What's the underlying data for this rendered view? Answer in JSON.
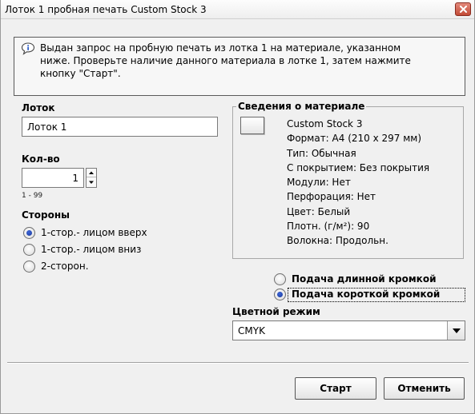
{
  "window": {
    "title": "Лоток 1 пробная печать Custom Stock 3"
  },
  "notice": {
    "line1": "Выдан запрос на пробную печать из лотка 1 на материале, указанном",
    "line2": "ниже.  Проверьте наличие данного материала в лотке 1, затем нажмите",
    "line3": "кнопку \"Старт\"."
  },
  "tray": {
    "label": "Лоток",
    "value": "Лоток 1"
  },
  "quantity": {
    "label": "Кол-во",
    "value": "1",
    "range": "1 - 99"
  },
  "sides": {
    "label": "Стороны",
    "options": [
      {
        "label": "1-стор.- лицом вверх",
        "checked": true
      },
      {
        "label": "1-стор.- лицом вниз",
        "checked": false
      },
      {
        "label": "2-сторон.",
        "checked": false
      }
    ]
  },
  "material": {
    "legend": "Сведения о материале",
    "lines": [
      "Custom Stock 3",
      "Формат: А4 (210 x 297 мм)",
      "Тип:  Обычная",
      "С покрытием: Без покрытия",
      "Модули: Нет",
      "Перфорация: Нет",
      "Цвет: Белый",
      "Плотн. (г/м²): 90",
      "Волокна: Продольн."
    ]
  },
  "feed": {
    "options": [
      {
        "label": "Подача длинной кромкой",
        "checked": false
      },
      {
        "label": "Подача короткой кромкой",
        "checked": true
      }
    ]
  },
  "color_mode": {
    "label": "Цветной режим",
    "value": "CMYK"
  },
  "buttons": {
    "start": "Старт",
    "cancel": "Отменить"
  }
}
